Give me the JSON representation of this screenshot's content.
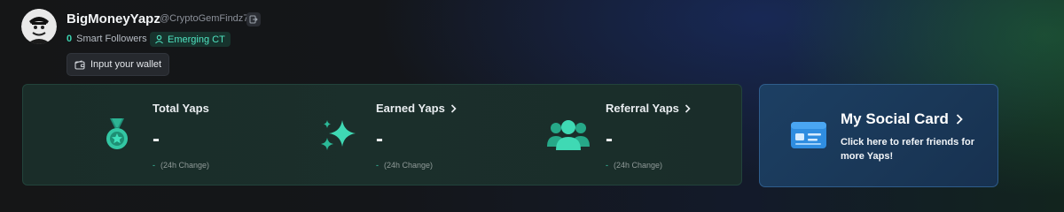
{
  "profile": {
    "name": "BigMoneyYapz",
    "handle": "@CryptoGemFindz7",
    "smart_followers_count": "0",
    "smart_followers_label": "Smart Followers",
    "badge": "Emerging CT",
    "wallet_button": "Input your wallet"
  },
  "stats": [
    {
      "title": "Total Yaps",
      "value": "-",
      "change_value": "-",
      "change_label": "(24h Change)",
      "has_chevron": false
    },
    {
      "title": "Earned Yaps",
      "value": "-",
      "change_value": "-",
      "change_label": "(24h Change)",
      "has_chevron": true
    },
    {
      "title": "Referral Yaps",
      "value": "-",
      "change_value": "-",
      "change_label": "(24h Change)",
      "has_chevron": true
    }
  ],
  "social_card": {
    "title": "My Social Card",
    "description": "Click here to refer friends for more Yaps!"
  },
  "colors": {
    "accent_teal": "#3bd3b0",
    "social_card_bg": "#1c3f63",
    "stats_card_bg": "#1a2d29"
  }
}
